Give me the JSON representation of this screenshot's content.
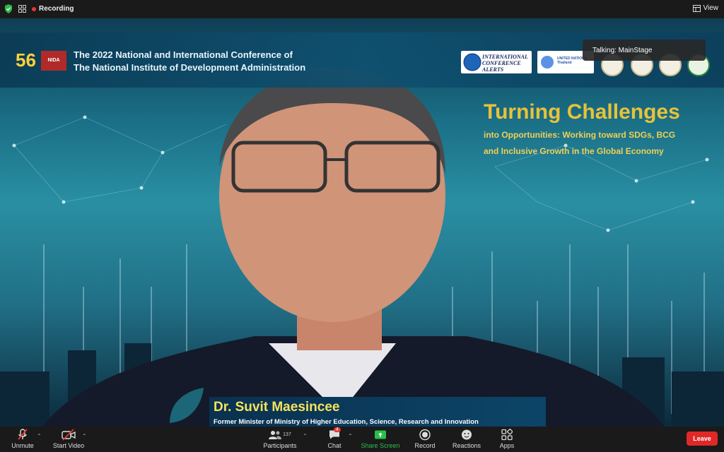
{
  "topbar": {
    "recording_label": "Recording",
    "view_label": "View"
  },
  "video": {
    "banner": {
      "anniversary_number": "56",
      "org_short": "NIDA",
      "title_line1": "The 2022 National and International Conference of",
      "title_line2": "The National Institute of Development Administration",
      "logo1_text": "INTERNATIONAL CONFERENCE ALERTS",
      "logo2_text": "UNITED NATIONS Thailand"
    },
    "headline": "Turning Challenges",
    "subtitle_line1": "into Opportunities: Working toward SDGs, BCG",
    "subtitle_line2": "and Inclusive Growth in the Global Economy",
    "talking_label": "Talking: MainStage",
    "speaker_name": "Dr. Suvit Maesincee",
    "speaker_role": "Former Minister of Ministry of Higher Education, Science, Research and Innovation"
  },
  "toolbar": {
    "unmute": "Unmute",
    "start_video": "Start Video",
    "participants": "Participants",
    "participants_count": "137",
    "chat": "Chat",
    "chat_badge": "4",
    "share_screen": "Share Screen",
    "record": "Record",
    "reactions": "Reactions",
    "apps": "Apps",
    "leave": "Leave"
  },
  "colors": {
    "share_green": "#28c04b",
    "leave_red": "#e02828",
    "headline_gold": "#e8c23a",
    "recording_red": "#e53935"
  }
}
